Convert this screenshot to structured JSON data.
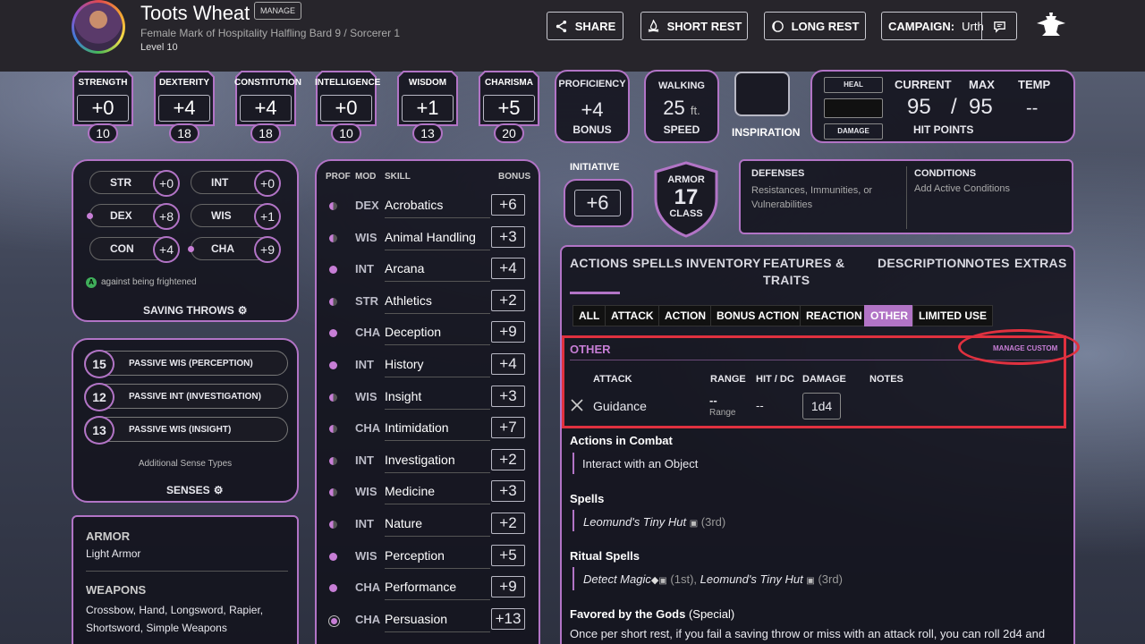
{
  "character": {
    "name": "Toots Wheat",
    "manage": "MANAGE",
    "description": "Female  Mark of Hospitality Halfling  Bard 9 / Sorcerer 1",
    "level": "Level 10"
  },
  "header_buttons": {
    "share": "SHARE",
    "short_rest": "SHORT REST",
    "long_rest": "LONG REST",
    "campaign": "CAMPAIGN:",
    "campaign_name": "Urth"
  },
  "abilities": [
    {
      "label": "STRENGTH",
      "mod": "+0",
      "score": "10"
    },
    {
      "label": "DEXTERITY",
      "mod": "+4",
      "score": "18"
    },
    {
      "label": "CONSTITUTION",
      "mod": "+4",
      "score": "18"
    },
    {
      "label": "INTELLIGENCE",
      "mod": "+0",
      "score": "10"
    },
    {
      "label": "WISDOM",
      "mod": "+1",
      "score": "13"
    },
    {
      "label": "CHARISMA",
      "mod": "+5",
      "score": "20"
    }
  ],
  "proficiency": {
    "label": "PROFICIENCY",
    "value": "+4",
    "sub": "BONUS"
  },
  "speed": {
    "label": "WALKING",
    "value": "25",
    "unit": "ft.",
    "sub": "SPEED"
  },
  "inspiration": "INSPIRATION",
  "hp": {
    "heal": "HEAL",
    "damage": "DAMAGE",
    "current_label": "CURRENT",
    "max_label": "MAX",
    "temp_label": "TEMP",
    "current": "95",
    "sep": "/",
    "max": "95",
    "temp": "--",
    "title": "HIT POINTS"
  },
  "initiative": {
    "label": "INITIATIVE",
    "value": "+6"
  },
  "armor": {
    "top": "ARMOR",
    "value": "17",
    "bottom": "CLASS"
  },
  "defenses": {
    "title": "DEFENSES",
    "text": "Resistances, Immunities, or Vulnerabilities"
  },
  "conditions": {
    "title": "CONDITIONS",
    "text": "Add Active Conditions"
  },
  "saves": [
    {
      "ab": "STR",
      "bonus": "+0",
      "prof": false
    },
    {
      "ab": "INT",
      "bonus": "+0",
      "prof": false
    },
    {
      "ab": "DEX",
      "bonus": "+8",
      "prof": true
    },
    {
      "ab": "WIS",
      "bonus": "+1",
      "prof": false
    },
    {
      "ab": "CON",
      "bonus": "+4",
      "prof": false
    },
    {
      "ab": "CHA",
      "bonus": "+9",
      "prof": true
    }
  ],
  "saves_note": "against being frightened",
  "saves_note_badge": "A",
  "saving_throws_title": "SAVING THROWS",
  "senses": [
    {
      "value": "15",
      "label": "PASSIVE WIS (PERCEPTION)"
    },
    {
      "value": "12",
      "label": "PASSIVE INT (INVESTIGATION)"
    },
    {
      "value": "13",
      "label": "PASSIVE WIS (INSIGHT)"
    }
  ],
  "senses_note": "Additional Sense Types",
  "senses_title": "SENSES",
  "proficiencies": {
    "armor_title": "ARMOR",
    "armor": "Light Armor",
    "weapons_title": "WEAPONS",
    "weapons": "Crossbow, Hand, Longsword, Rapier, Shortsword, Simple Weapons"
  },
  "skills_header": {
    "prof": "PROF",
    "mod": "MOD",
    "skill": "SKILL",
    "bonus": "BONUS"
  },
  "skills": [
    {
      "mod": "DEX",
      "name": "Acrobatics",
      "bonus": "+6",
      "prof": "half"
    },
    {
      "mod": "WIS",
      "name": "Animal Handling",
      "bonus": "+3",
      "prof": "half"
    },
    {
      "mod": "INT",
      "name": "Arcana",
      "bonus": "+4",
      "prof": "full"
    },
    {
      "mod": "STR",
      "name": "Athletics",
      "bonus": "+2",
      "prof": "half"
    },
    {
      "mod": "CHA",
      "name": "Deception",
      "bonus": "+9",
      "prof": "full"
    },
    {
      "mod": "INT",
      "name": "History",
      "bonus": "+4",
      "prof": "full"
    },
    {
      "mod": "WIS",
      "name": "Insight",
      "bonus": "+3",
      "prof": "half"
    },
    {
      "mod": "CHA",
      "name": "Intimidation",
      "bonus": "+7",
      "prof": "half"
    },
    {
      "mod": "INT",
      "name": "Investigation",
      "bonus": "+2",
      "prof": "half"
    },
    {
      "mod": "WIS",
      "name": "Medicine",
      "bonus": "+3",
      "prof": "half"
    },
    {
      "mod": "INT",
      "name": "Nature",
      "bonus": "+2",
      "prof": "half"
    },
    {
      "mod": "WIS",
      "name": "Perception",
      "bonus": "+5",
      "prof": "full"
    },
    {
      "mod": "CHA",
      "name": "Performance",
      "bonus": "+9",
      "prof": "full"
    },
    {
      "mod": "CHA",
      "name": "Persuasion",
      "bonus": "+13",
      "prof": "expert"
    }
  ],
  "main_tabs": [
    "ACTIONS",
    "SPELLS",
    "INVENTORY",
    "FEATURES &",
    "TRAITS",
    "DESCRIPTION",
    "NOTES",
    "EXTRAS"
  ],
  "filter_tabs": [
    "ALL",
    "ATTACK",
    "ACTION",
    "BONUS ACTION",
    "REACTION",
    "OTHER",
    "LIMITED USE"
  ],
  "other": {
    "title": "OTHER",
    "manage_custom": "MANAGE CUSTOM",
    "columns": {
      "attack": "ATTACK",
      "range": "RANGE",
      "hit": "HIT / DC",
      "damage": "DAMAGE",
      "notes": "NOTES"
    },
    "row": {
      "name": "Guidance",
      "range": "--",
      "range_sub": "Range",
      "hit": "--",
      "damage": "1d4"
    }
  },
  "actions_in_combat": {
    "title": "Actions in Combat",
    "item": "Interact with an Object"
  },
  "spells": {
    "title": "Spells",
    "name": "Leomund's Tiny Hut",
    "level": "(3rd)"
  },
  "ritual_spells": {
    "title": "Ritual Spells",
    "spell1": "Detect Magic",
    "level1": "(1st),",
    "spell2": "Leomund's Tiny Hut",
    "level2": "(3rd)"
  },
  "favored": {
    "title": "Favored by the Gods",
    "tag": "(Special)",
    "text": "Once per short rest, if you fail a saving throw or miss with an attack roll, you can roll 2d4 and"
  },
  "colors": {
    "accent": "#b274c6",
    "highlight": "#e0313f"
  }
}
